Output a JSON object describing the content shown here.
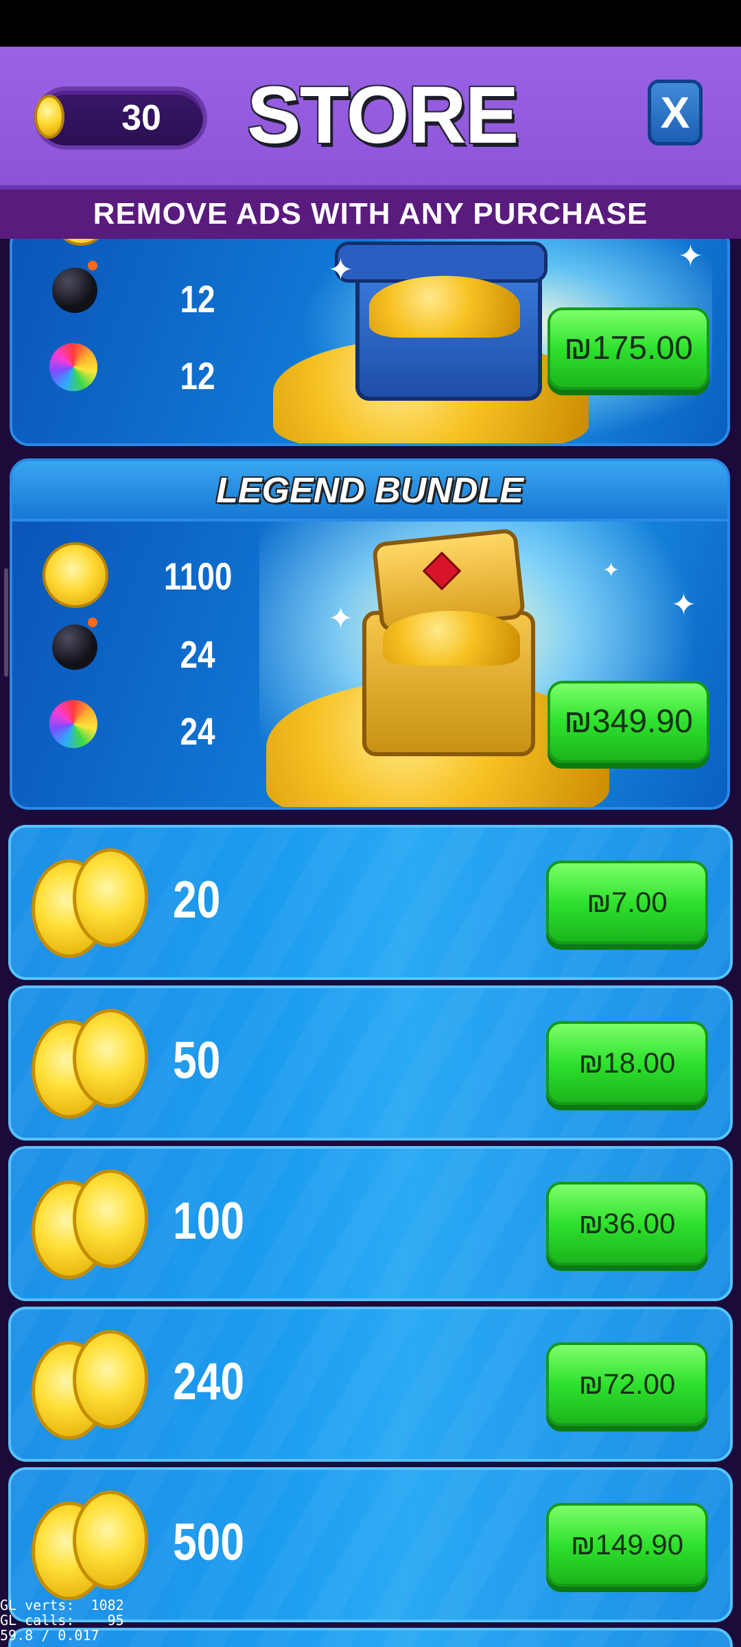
{
  "header": {
    "coin_balance": "30",
    "title": "STORE",
    "close_label": "X"
  },
  "banner": {
    "text": "REMOVE ADS WITH ANY PURCHASE"
  },
  "bundles": [
    {
      "name": "",
      "items": [
        {
          "icon": "bomb-icon",
          "quantity": "12"
        },
        {
          "icon": "rainbow-ball-icon",
          "quantity": "12"
        }
      ],
      "price": "₪175.00"
    },
    {
      "name": "LEGEND BUNDLE",
      "items": [
        {
          "icon": "coin-icon",
          "quantity": "1100"
        },
        {
          "icon": "bomb-icon",
          "quantity": "24"
        },
        {
          "icon": "rainbow-ball-icon",
          "quantity": "24"
        }
      ],
      "price": "₪349.90"
    }
  ],
  "coin_packs": [
    {
      "amount": "20",
      "price": "₪7.00"
    },
    {
      "amount": "50",
      "price": "₪18.00"
    },
    {
      "amount": "100",
      "price": "₪36.00"
    },
    {
      "amount": "240",
      "price": "₪72.00"
    },
    {
      "amount": "500",
      "price": "₪149.90"
    }
  ],
  "debug_overlay": {
    "line1": "GL verts:  1082",
    "line2": "GL calls:    95",
    "line3": "59.8 / 0.017"
  },
  "colors": {
    "header_purple": "#9a63e6",
    "banner_purple": "#5a1b7e",
    "card_blue": "#1b9bef",
    "button_green": "#2fe12d"
  }
}
